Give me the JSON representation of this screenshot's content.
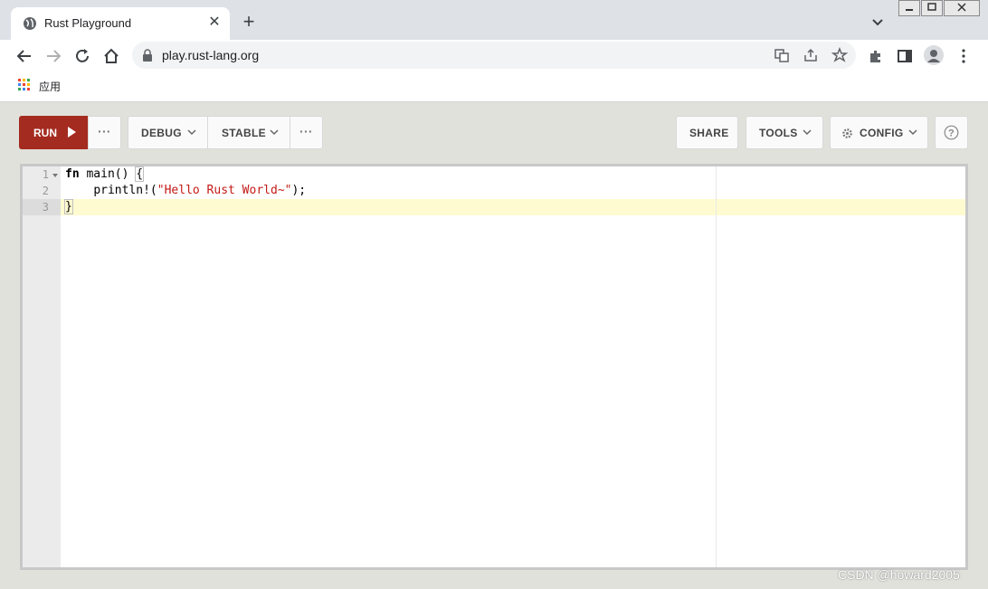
{
  "browser": {
    "tab_title": "Rust Playground",
    "url": "play.rust-lang.org",
    "bookmark_apps_label": "应用",
    "icons": [
      "globe-icon",
      "close-icon",
      "plus-icon",
      "chevron-down-icon",
      "back-icon",
      "forward-icon",
      "reload-icon",
      "home-icon",
      "lock-icon",
      "translate-icon",
      "share-icon",
      "star-icon",
      "extensions-icon",
      "side-panel-icon",
      "profile-icon",
      "menu-icon",
      "apps-grid-icon"
    ]
  },
  "toolbar": {
    "run_label": "RUN",
    "more_label": "···",
    "mode_label": "DEBUG",
    "channel_label": "STABLE",
    "more2_label": "···",
    "share_label": "SHARE",
    "tools_label": "TOOLS",
    "config_label": "CONFIG",
    "help_label": "?"
  },
  "editor": {
    "line_numbers": [
      "1",
      "2",
      "3"
    ],
    "lines": [
      {
        "kw": "fn",
        "rest": " main() ",
        "brace": "{"
      },
      {
        "indent": "    ",
        "call": "println!(",
        "str": "\"Hello Rust World~\"",
        "end": ");"
      },
      {
        "brace": "}"
      }
    ]
  },
  "watermark": "CSDN @howard2005",
  "colors": {
    "run": "#a42b20",
    "active_line": "#fffbd1",
    "string": "#c41a16"
  }
}
